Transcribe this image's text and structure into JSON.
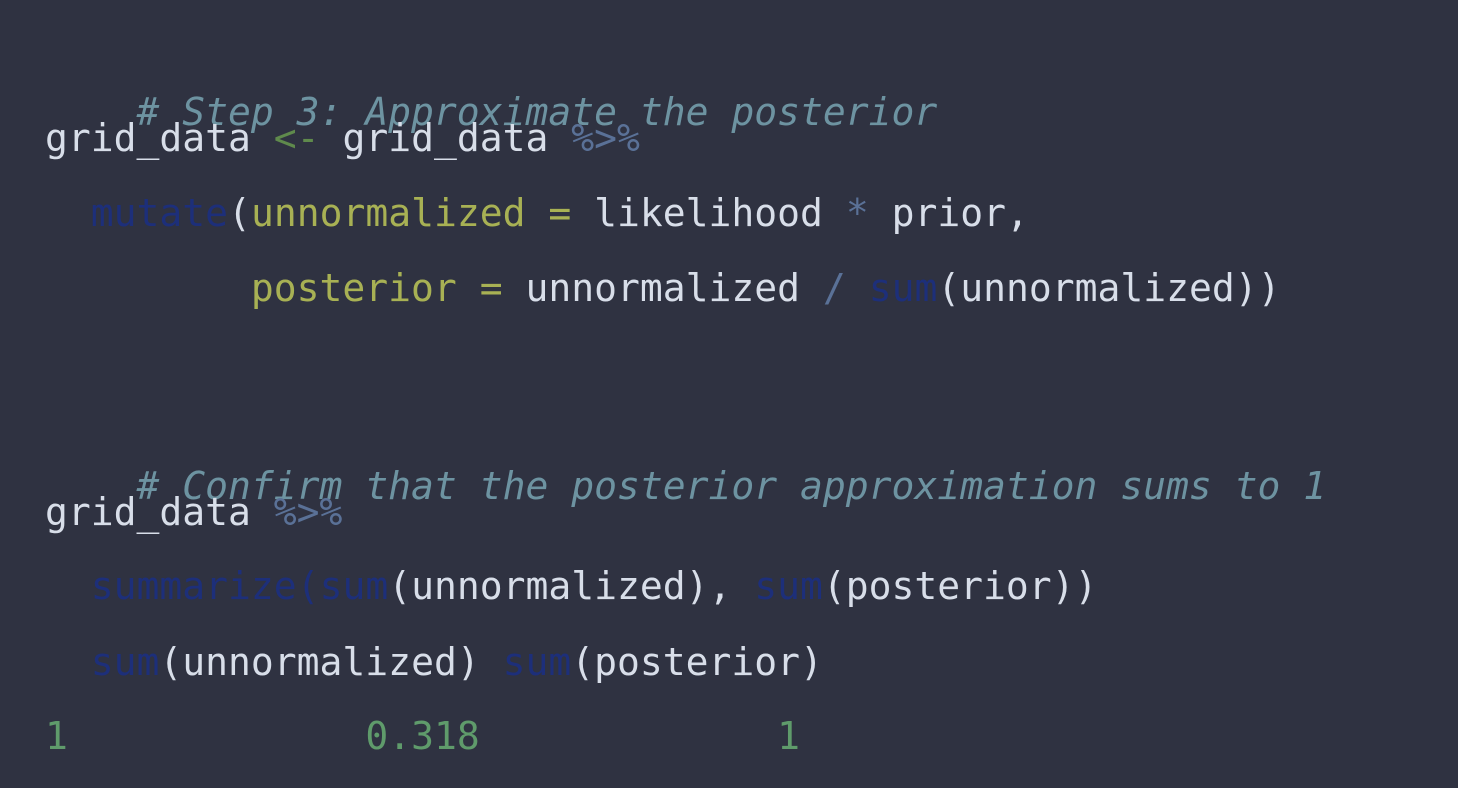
{
  "code": {
    "line1": {
      "comment": "# Step 3: Approximate the posterior"
    },
    "line2": {
      "var": "grid_data",
      "assign": "<-",
      "var2": "grid_data",
      "pipe": "%>%"
    },
    "line3": {
      "fn": "mutate",
      "open": "(",
      "arg": "unnormalized",
      "eq": "=",
      "a": "likelihood",
      "op": "*",
      "b": "prior,"
    },
    "line4": {
      "arg": "posterior",
      "eq": "=",
      "a": "unnormalized",
      "op": "/",
      "fn": "sum",
      "rest": "(unnormalized))"
    },
    "line6": {
      "comment": "# Confirm that the posterior approximation sums to 1"
    },
    "line7": {
      "var": "grid_data",
      "pipe": "%>%"
    },
    "line8": {
      "fn1": "summarize",
      "open": "(",
      "fn2": "sum",
      "t1": "(unnormalized), ",
      "fn3": "sum",
      "t2": "(posterior))"
    }
  },
  "output": {
    "header": {
      "fn1": "sum",
      "t1": "(unnormalized) ",
      "fn2": "sum",
      "t2": "(posterior)"
    },
    "row": {
      "index": "1",
      "v1": "0.318",
      "v2": "1"
    }
  },
  "colors": {
    "background": "#2f3241",
    "comment": "#6d93a1",
    "text": "#d8dee9",
    "function": "#1d2f7a",
    "argument": "#a8b154",
    "operator": "#5a7197",
    "number": "#5f9b6b"
  }
}
